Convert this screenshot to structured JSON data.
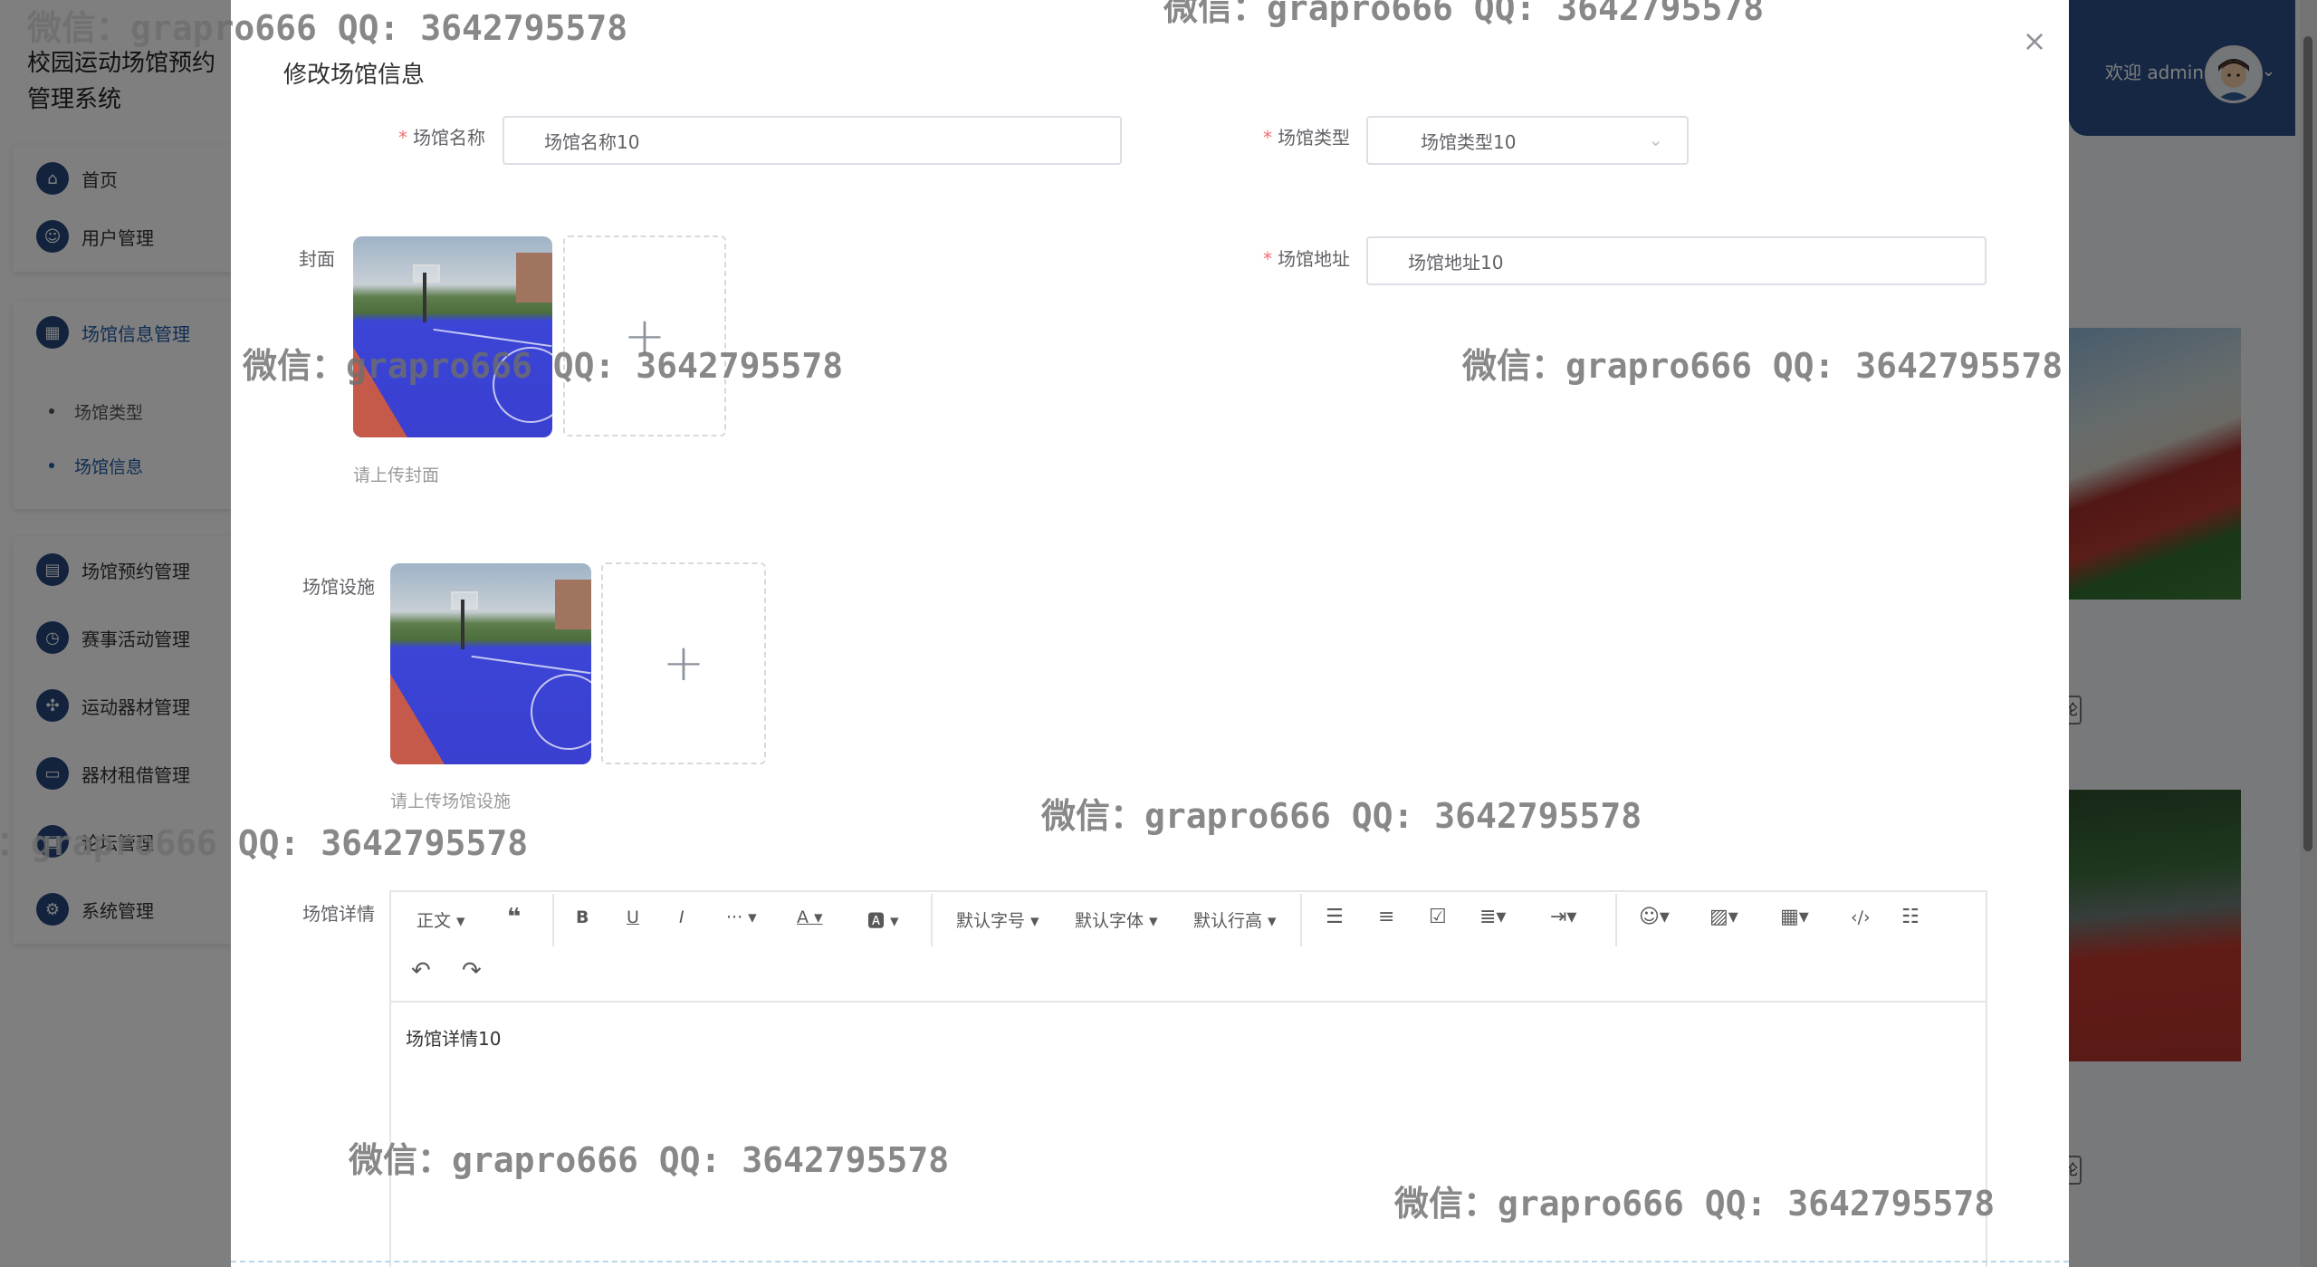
{
  "app": {
    "title": "校园运动场馆预约管理系统",
    "welcome": "欢迎 admin"
  },
  "sidebar": {
    "items": [
      {
        "label": "首页",
        "icon": "home-icon"
      },
      {
        "label": "用户管理",
        "icon": "user-icon"
      },
      {
        "label": "场馆信息管理",
        "icon": "grid-icon"
      },
      {
        "label": "场馆预约管理",
        "icon": "calendar-icon"
      },
      {
        "label": "赛事活动管理",
        "icon": "trophy-icon"
      },
      {
        "label": "运动器材管理",
        "icon": "equipment-icon"
      },
      {
        "label": "器材租借管理",
        "icon": "rental-icon"
      },
      {
        "label": "论坛管理",
        "icon": "forum-icon"
      },
      {
        "label": "系统管理",
        "icon": "settings-icon"
      }
    ],
    "sub_items": [
      {
        "label": "场馆类型"
      },
      {
        "label": "场馆信息"
      }
    ]
  },
  "dialog": {
    "title": "修改场馆信息",
    "close_symbol": "×",
    "name_label": "场馆名称",
    "name_value": "场馆名称10",
    "type_label": "场馆类型",
    "type_value": "场馆类型10",
    "cover_label": "封面",
    "cover_tip": "请上传封面",
    "address_label": "场馆地址",
    "address_value": "场馆地址10",
    "facility_label": "场馆设施",
    "facility_tip": "请上传场馆设施",
    "detail_label": "场馆详情",
    "detail_value": "场馆详情10"
  },
  "editor": {
    "paragraph": "正文",
    "font_size": "默认字号",
    "font_family": "默认字体",
    "line_height": "默认行高"
  },
  "watermark": "微信：grapro666 QQ: 3642795578",
  "colors": {
    "sidebar_icon_bg": "#26477c",
    "header_bg": "#2c4f86",
    "required": "#f56c6c",
    "active_nav": "#1f5aa6"
  }
}
